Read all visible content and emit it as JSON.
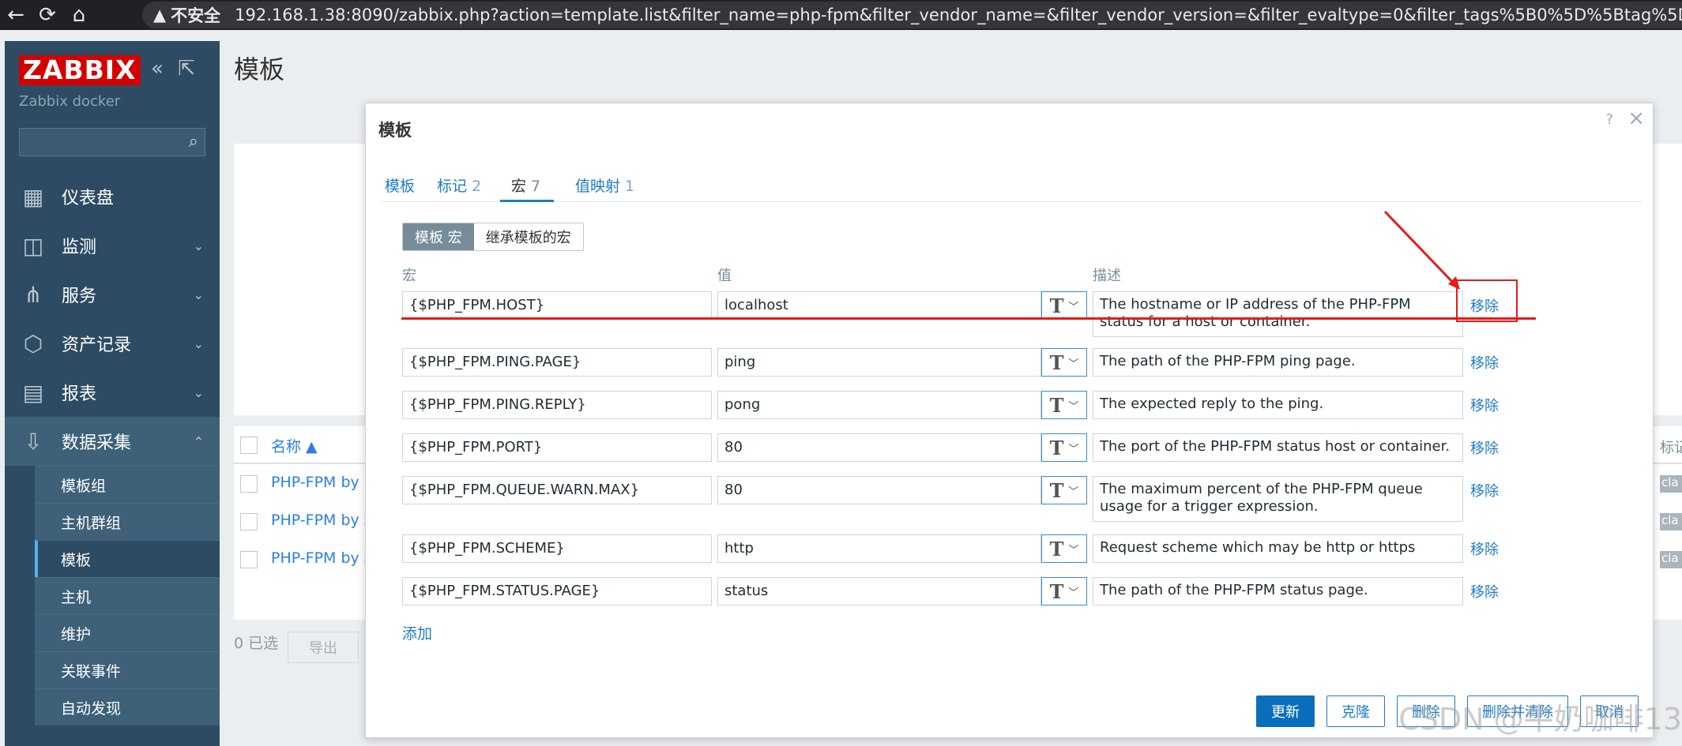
{
  "browser": {
    "security": "不安全",
    "url": "192.168.1.38:8090/zabbix.php?action=template.list&filter_name=php-fpm&filter_vendor_name=&filter_vendor_version=&filter_evaltype=0&filter_tags%5B0%5D%5Btag%5D=&filter_tags%5B"
  },
  "sidebar": {
    "logo": "ZABBIX",
    "server_name": "Zabbix docker",
    "menu": [
      {
        "label": "仪表盘",
        "icon": "dashboard-icon"
      },
      {
        "label": "监测",
        "icon": "monitoring-icon"
      },
      {
        "label": "服务",
        "icon": "services-icon"
      },
      {
        "label": "资产记录",
        "icon": "inventory-icon"
      },
      {
        "label": "报表",
        "icon": "reports-icon"
      },
      {
        "label": "数据采集",
        "icon": "data-collection-icon"
      }
    ],
    "submenu": [
      "模板组",
      "主机群组",
      "模板",
      "主机",
      "维护",
      "关联事件",
      "自动发现"
    ]
  },
  "page": {
    "title": "模板",
    "list_name_header": "名称 ▲",
    "list_rows": [
      "PHP-FPM by I",
      "PHP-FPM by Z",
      "PHP-FPM by Z"
    ],
    "right_header": "标记",
    "right_tag": "cla",
    "selected": "0 已选",
    "export": "导出"
  },
  "modal": {
    "title": "模板",
    "help": "?",
    "close": "×",
    "tabs": [
      {
        "label": "模板",
        "count": ""
      },
      {
        "label": "标记",
        "count": "2"
      },
      {
        "label": "宏",
        "count": "7"
      },
      {
        "label": "值映射",
        "count": "1"
      }
    ],
    "segment": {
      "template_macros": "模板 宏",
      "inherited_macros": "继承模板的宏"
    },
    "columns": {
      "macro": "宏",
      "value": "值",
      "description": "描述"
    },
    "macros": [
      {
        "macro": "{$PHP_FPM.HOST}",
        "value": "localhost",
        "description": "The hostname or IP address of the PHP-FPM status for a host or container."
      },
      {
        "macro": "{$PHP_FPM.PING.PAGE}",
        "value": "ping",
        "description": "The path of the PHP-FPM ping page."
      },
      {
        "macro": "{$PHP_FPM.PING.REPLY}",
        "value": "pong",
        "description": "The expected reply to the ping."
      },
      {
        "macro": "{$PHP_FPM.PORT}",
        "value": "80",
        "description": "The port of the PHP-FPM status host or container."
      },
      {
        "macro": "{$PHP_FPM.QUEUE.WARN.MAX}",
        "value": "80",
        "description": "The maximum percent of the PHP-FPM queue usage for a trigger expression."
      },
      {
        "macro": "{$PHP_FPM.SCHEME}",
        "value": "http",
        "description": "Request scheme which may be http or https"
      },
      {
        "macro": "{$PHP_FPM.STATUS.PAGE}",
        "value": "status",
        "description": "The path of the PHP-FPM status page."
      }
    ],
    "type_glyph": "T",
    "remove": "移除",
    "add": "添加",
    "buttons": {
      "update": "更新",
      "clone": "克隆",
      "delete": "删除",
      "delete_clear": "删除并清除",
      "cancel": "取消"
    }
  },
  "annotation": {
    "color": "#e61a1a"
  },
  "watermark": "CSDN @牛奶咖啡13"
}
